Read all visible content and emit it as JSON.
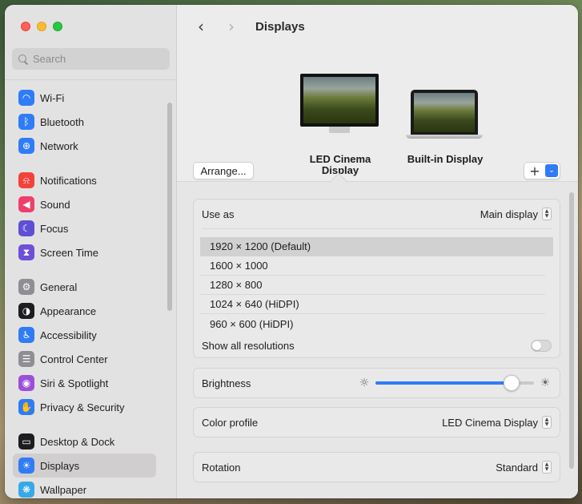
{
  "sidebar": {
    "search_placeholder": "Search",
    "groups": [
      [
        {
          "label": "Wi-Fi",
          "icon": "wifi-icon",
          "color": "#2f7cf6",
          "glyph": "◠"
        },
        {
          "label": "Bluetooth",
          "icon": "bluetooth-icon",
          "color": "#2f7cf6",
          "glyph": "ᛒ"
        },
        {
          "label": "Network",
          "icon": "globe-icon",
          "color": "#2f7cf6",
          "glyph": "⊕"
        }
      ],
      [
        {
          "label": "Notifications",
          "icon": "bell-icon",
          "color": "#f2433b",
          "glyph": "⍾"
        },
        {
          "label": "Sound",
          "icon": "speaker-icon",
          "color": "#f03e6a",
          "glyph": "◀"
        },
        {
          "label": "Focus",
          "icon": "moon-icon",
          "color": "#5f4fd4",
          "glyph": "☾"
        },
        {
          "label": "Screen Time",
          "icon": "hourglass-icon",
          "color": "#6f4fd8",
          "glyph": "⧗"
        }
      ],
      [
        {
          "label": "General",
          "icon": "gear-icon",
          "color": "#8e8e93",
          "glyph": "⚙"
        },
        {
          "label": "Appearance",
          "icon": "appearance-icon",
          "color": "#1d1d1f",
          "glyph": "◑"
        },
        {
          "label": "Accessibility",
          "icon": "accessibility-icon",
          "color": "#2f7cf6",
          "glyph": "♿"
        },
        {
          "label": "Control Center",
          "icon": "control-center-icon",
          "color": "#8e8e93",
          "glyph": "☰"
        },
        {
          "label": "Siri & Spotlight",
          "icon": "siri-icon",
          "color": "#9c4fd8",
          "glyph": "◉"
        },
        {
          "label": "Privacy & Security",
          "icon": "hand-icon",
          "color": "#2f7cf6",
          "glyph": "✋"
        }
      ],
      [
        {
          "label": "Desktop & Dock",
          "icon": "dock-icon",
          "color": "#1d1d1f",
          "glyph": "▭"
        },
        {
          "label": "Displays",
          "icon": "sun-icon",
          "color": "#2f7cf6",
          "glyph": "☀",
          "selected": true
        },
        {
          "label": "Wallpaper",
          "icon": "flower-icon",
          "color": "#36a9e6",
          "glyph": "❋"
        }
      ]
    ]
  },
  "main": {
    "title": "Displays",
    "back_glyph": "‹",
    "forward_glyph": "›",
    "arrange_label": "Arrange...",
    "add_glyph": "+",
    "chevron_glyph": "⌄",
    "displays": [
      {
        "name": "LED Cinema Display",
        "selected": true
      },
      {
        "name": "Built-in Display",
        "selected": false
      }
    ],
    "use_as": {
      "label": "Use as",
      "value": "Main display"
    },
    "resolutions": [
      {
        "label": "1920 × 1200 (Default)",
        "selected": true
      },
      {
        "label": "1600 × 1000",
        "selected": false
      },
      {
        "label": "1280 × 800",
        "selected": false
      },
      {
        "label": "1024 × 640 (HiDPI)",
        "selected": false
      },
      {
        "label": "960 × 600 (HiDPI)",
        "selected": false
      }
    ],
    "show_all": {
      "label": "Show all resolutions",
      "on": false
    },
    "brightness": {
      "label": "Brightness",
      "value": 0.9
    },
    "color_profile": {
      "label": "Color profile",
      "value": "LED Cinema Display"
    },
    "rotation": {
      "label": "Rotation",
      "value": "Standard"
    }
  }
}
